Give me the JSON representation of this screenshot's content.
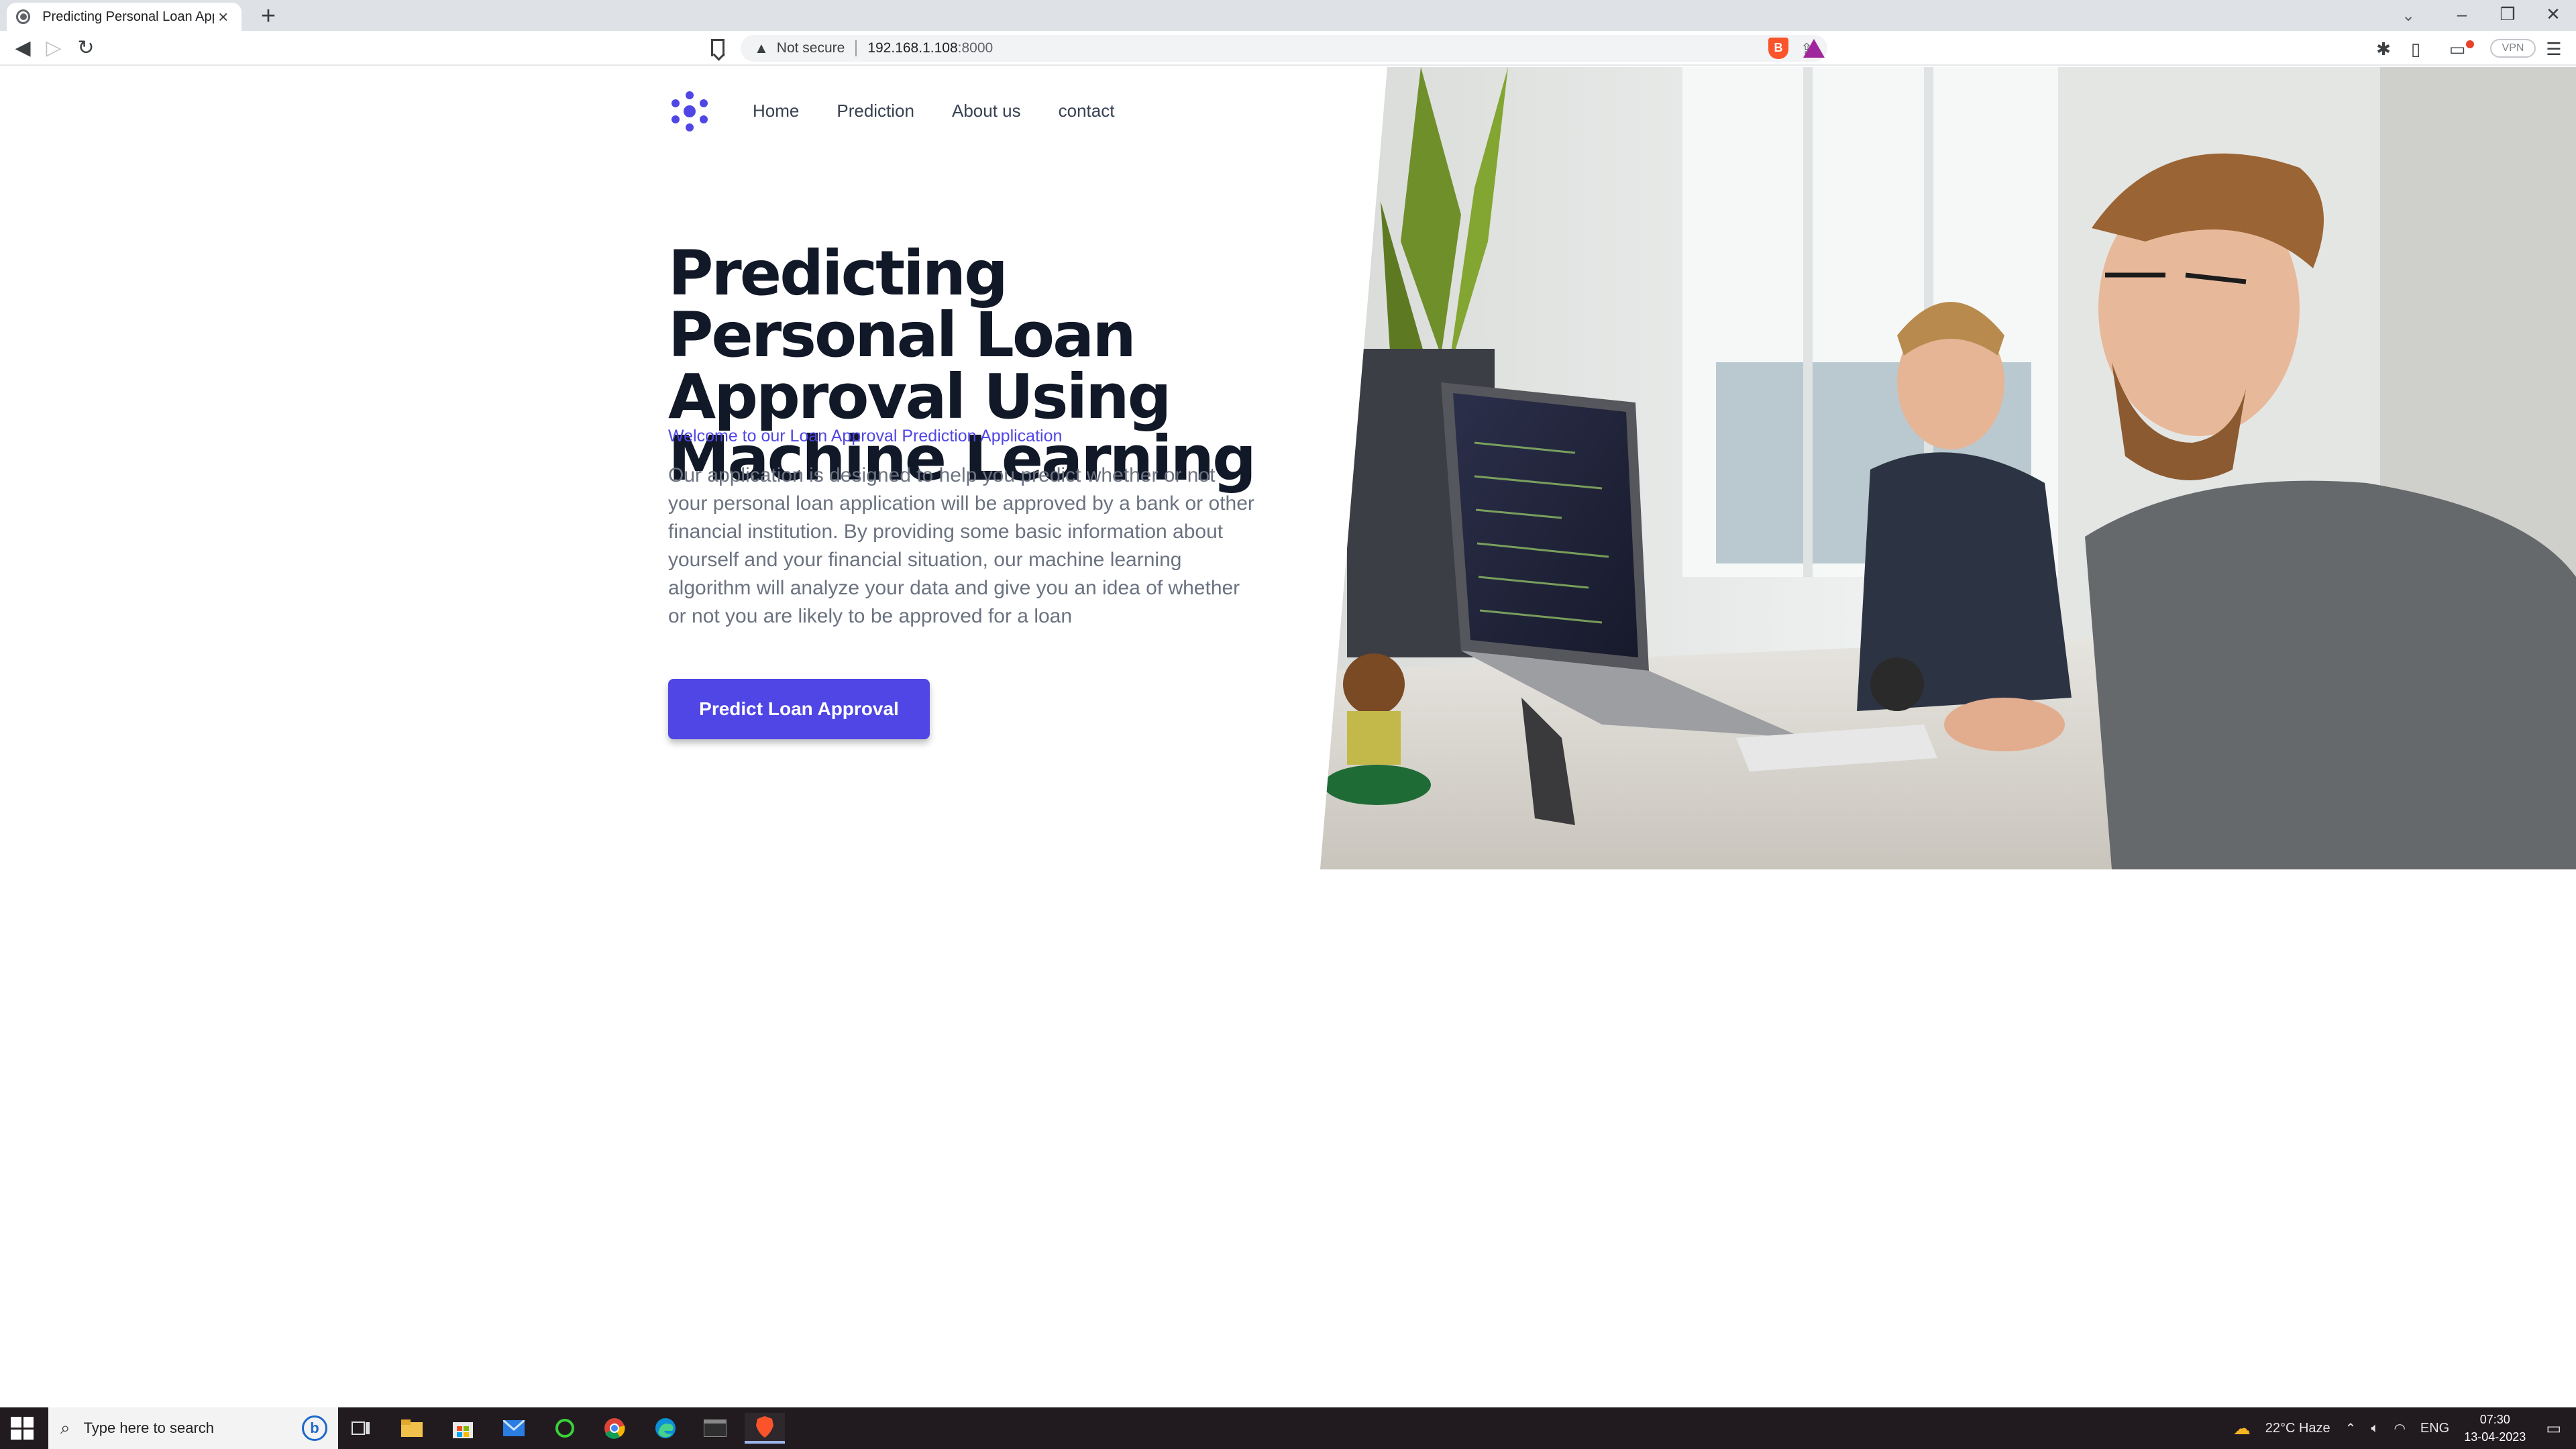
{
  "browser": {
    "tab_title": "Predicting Personal Loan Approv",
    "new_tab": "+",
    "close_tab": "×",
    "security_label": "Not secure",
    "url_host": "192.168.1.108",
    "url_port": ":8000",
    "vpn_label": "VPN",
    "window_controls": {
      "collapse": "⌄",
      "minimize": "–",
      "restore": "❐",
      "close": "✕"
    }
  },
  "page": {
    "nav": {
      "items": [
        {
          "label": "Home"
        },
        {
          "label": "Prediction"
        },
        {
          "label": "About us"
        },
        {
          "label": "contact"
        }
      ]
    },
    "hero": {
      "title": "Predicting Personal Loan Approval Using Machine Learning",
      "tagline": "Welcome to our Loan Approval Prediction Application",
      "description": "Our application is designed to help you predict whether or not your personal loan application will be approved by a bank or other financial institution. By providing some basic information about yourself and your financial situation, our machine learning algorithm will analyze your data and give you an idea of whether or not you are likely to be approved for a loan",
      "cta_label": "Predict Loan Approval"
    },
    "colors": {
      "accent": "#4f46e5",
      "heading": "#111827",
      "body_text": "#6b7280"
    }
  },
  "taskbar": {
    "search_placeholder": "Type here to search",
    "weather": "22°C  Haze",
    "language": "ENG",
    "time": "07:30",
    "date": "13-04-2023"
  }
}
